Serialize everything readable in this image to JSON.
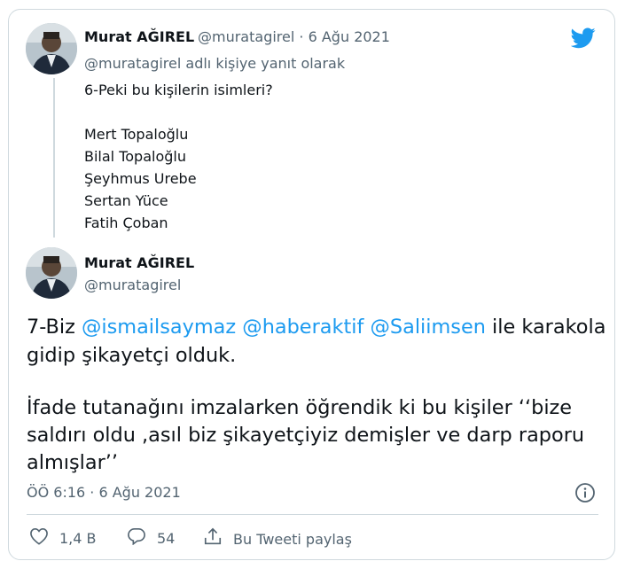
{
  "parent_tweet": {
    "author_name": "Murat AĞIREL",
    "author_handle": "@muratagirel",
    "separator": "·",
    "date": "6 Ağu 2021",
    "reply_context": "@muratagirel adlı kişiye yanıt olarak",
    "lines": [
      "6-Peki bu kişilerin isimleri?",
      "Mert Topaloğlu",
      "Bilal Topaloğlu",
      "Şeyhmus Urebe",
      "Sertan Yüce",
      "Fatih Çoban"
    ]
  },
  "main_tweet": {
    "author_name": "Murat AĞIREL",
    "author_handle": "@muratagirel",
    "text_prefix": "7-Biz ",
    "mentions": [
      "@ismailsaymaz",
      "@haberaktif",
      "@Saliimsen"
    ],
    "text_suffix": " ile karakola",
    "line2": "gidip şikayetçi olduk.",
    "line3": "İfade tutanağını imzalarken öğrendik ki bu kişiler ‘‘bize",
    "line4": "saldırı oldu ,asıl biz şikayetçiyiz demişler ve darp raporu",
    "line5": "almışlar’’",
    "timestamp": "ÖÖ 6:16 · 6 Ağu 2021"
  },
  "actions": {
    "like_count": "1,4 B",
    "reply_count": "54",
    "share_label": "Bu Tweeti paylaş"
  },
  "colors": {
    "accent": "#1d9bf0",
    "secondary_text": "#536471",
    "border": "#cfd9de"
  },
  "icons": [
    "twitter-bird-icon",
    "info-icon",
    "heart-icon",
    "reply-icon",
    "share-icon"
  ]
}
